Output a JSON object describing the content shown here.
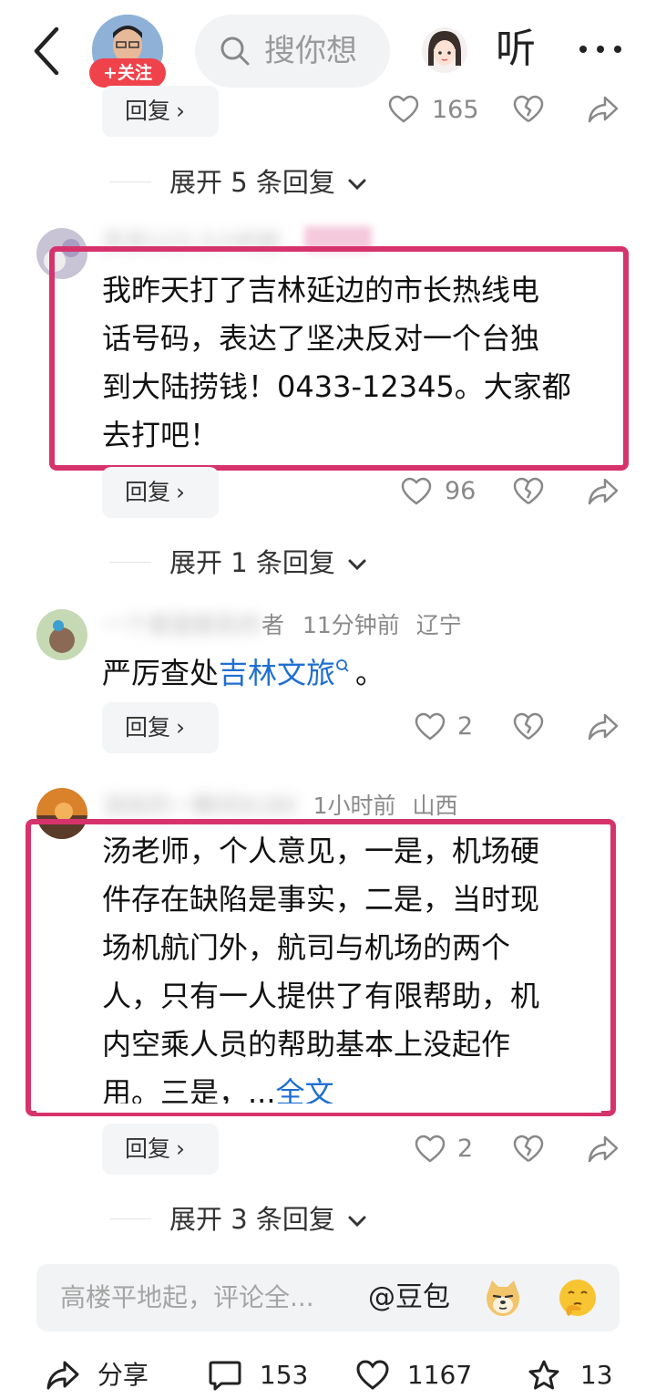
{
  "top_bar": {
    "follow_label": "+关注",
    "search_placeholder": "搜你想",
    "listen_label": "听"
  },
  "top_partial": {
    "reply_label": "回复",
    "likes": "165",
    "expand_label": "展开 5 条回复"
  },
  "comments": [
    {
      "meta_hidden": "京京123 2小时前",
      "lines": [
        "我昨天打了吉林延边的市长热线电",
        "话号码，表达了坚决反对一个台独",
        "到大陆捞钱！0433-12345。大家都",
        "去打吧！"
      ],
      "reply_label": "回复",
      "likes": "96",
      "expand_label": "展开 1 条回复"
    },
    {
      "meta_name_hidden": "一个爱国爱民的",
      "meta_name_visible": "者",
      "time": "11分钟前",
      "location": "辽宁",
      "text_prefix": "严厉查处",
      "text_link": "吉林文旅",
      "text_suffix": "。",
      "reply_label": "回复",
      "likes": "2"
    },
    {
      "meta_name_hidden": "泪目的",
      "meta_name_mid_hidden": "一瞬间",
      "meta_name_tail": "9180",
      "time": "1小时前",
      "location": "山西",
      "lines": [
        "汤老师，个人意见，一是，机场硬",
        "件存在缺陷是事实，二是，当时现",
        "场机航门外，航司与机场的两个",
        "人，只有一人提供了有限帮助，机",
        "内空乘人员的帮助基本上没起作"
      ],
      "last_line_prefix": "用。三是，...",
      "full_text_label": "全文",
      "reply_label": "回复",
      "likes": "2",
      "expand_label": "展开 3 条回复"
    }
  ],
  "input_bar": {
    "placeholder": "高楼平地起，评论全...",
    "mention": "@豆包"
  },
  "bottom_bar": {
    "share_label": "分享",
    "comment_count": "153",
    "like_count": "1167",
    "favorite_count": "13"
  },
  "colors": {
    "highlight_border": "#d6336c",
    "follow_button": "#f0424a",
    "link": "#1f6fd1"
  }
}
